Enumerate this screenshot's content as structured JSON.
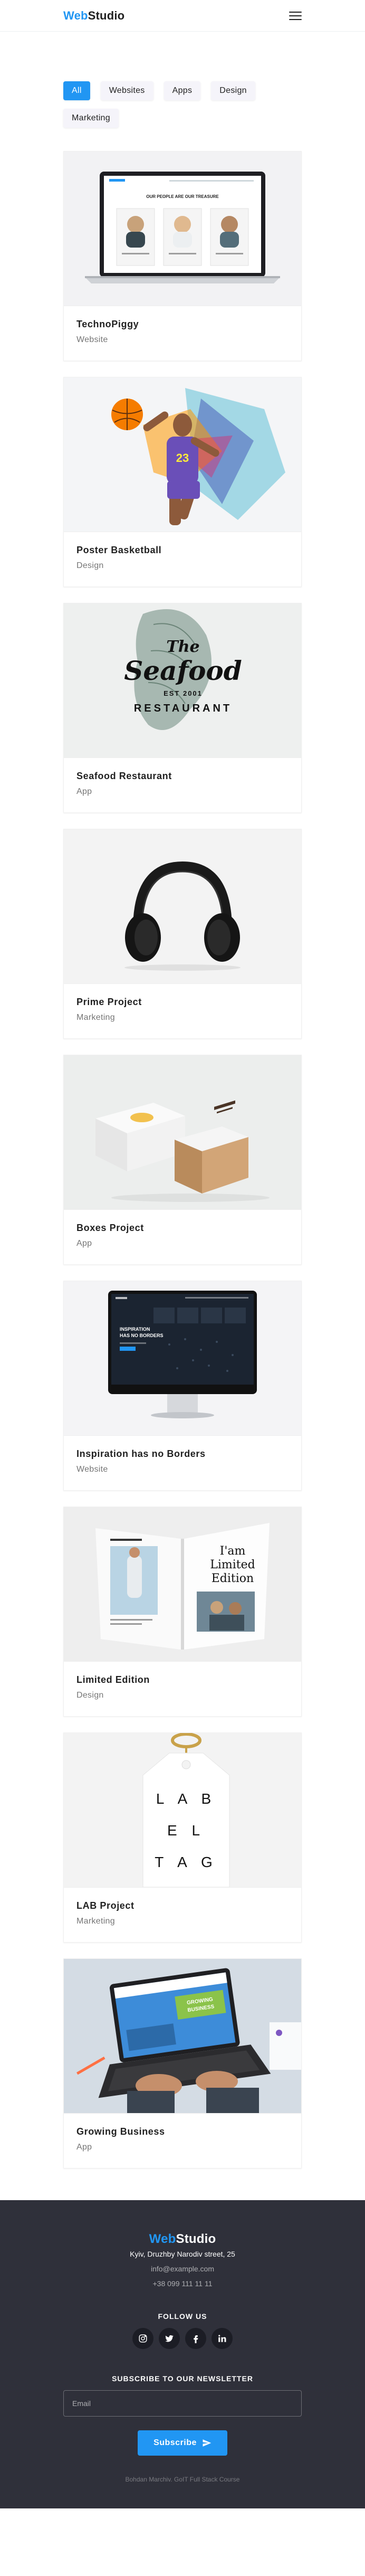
{
  "header": {
    "logo_accent": "Web",
    "logo_rest": "Studio",
    "menu_icon": "hamburger-menu-icon"
  },
  "filters": [
    {
      "label": "All",
      "active": true
    },
    {
      "label": "Websites",
      "active": false
    },
    {
      "label": "Apps",
      "active": false
    },
    {
      "label": "Design",
      "active": false
    },
    {
      "label": "Marketing",
      "active": false
    }
  ],
  "portfolio": [
    {
      "title": "TechnoPiggy",
      "tag": "Website"
    },
    {
      "title": "Poster Basketball",
      "tag": "Design"
    },
    {
      "title": "Seafood Restaurant",
      "tag": "App"
    },
    {
      "title": "Prime Project",
      "tag": "Marketing"
    },
    {
      "title": "Boxes Project",
      "tag": "App"
    },
    {
      "title": "Inspiration has no Borders",
      "tag": "Website"
    },
    {
      "title": "Limited Edition",
      "tag": "Design"
    },
    {
      "title": "LAB Project",
      "tag": "Marketing"
    },
    {
      "title": "Growing Business",
      "tag": "App"
    }
  ],
  "images": {
    "seafood_the": "The",
    "seafood_main": "Seafood",
    "seafood_est": "EST 2001",
    "seafood_sub": "RESTAURANT",
    "laptop_headline": "OUR PEOPLE ARE OUR TREASURE",
    "monitor_headline_1": "INSPIRATION",
    "monitor_headline_2": "HAS NO BORDERS",
    "book_line_1": "I'am",
    "book_line_2": "Limited",
    "book_line_3": "Edition",
    "tag_line_1": "L A B",
    "tag_line_2": "E L",
    "tag_line_3": "T A G",
    "growing_banner_1": "GROWING",
    "growing_banner_2": "BUSINESS"
  },
  "footer": {
    "logo_accent": "Web",
    "logo_rest": "Studio",
    "address": "Kyiv, Druzhby Narodiv street, 25",
    "email": "info@example.com",
    "phone": "+38 099 111 11 11",
    "follow_heading": "Follow us",
    "socials": [
      "instagram-icon",
      "twitter-icon",
      "facebook-icon",
      "linkedin-icon"
    ],
    "newsletter_heading": "Subscribe to our newsletter",
    "email_placeholder": "Email",
    "subscribe_label": "Subscribe",
    "copyright": "Bohdan Marchiv. GoIT Full Stack Course"
  },
  "colors": {
    "accent": "#2196f3",
    "footer_bg": "#2f303a",
    "filter_bg": "#f5f4fa"
  }
}
